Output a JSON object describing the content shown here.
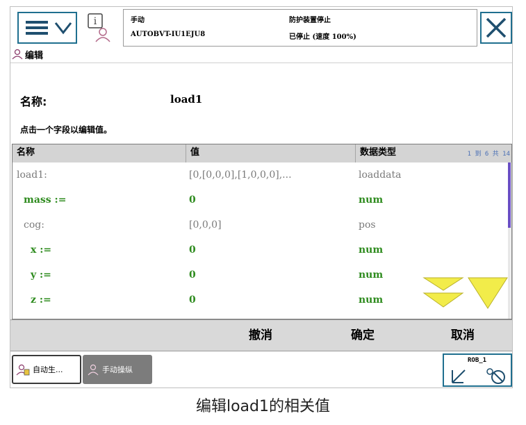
{
  "topbar": {
    "mode": "手动",
    "controller": "AUTOBVT-IU1EJU8",
    "status": "防护装置停止",
    "state": "已停止 (速度 100%)"
  },
  "tab": {
    "label": "编辑"
  },
  "form": {
    "name_label": "名称:",
    "name_value": "load1",
    "instruction": "点击一个字段以编辑值。"
  },
  "table": {
    "headers": [
      "名称",
      "值",
      "数据类型"
    ],
    "pager": "1 到 6 共 14",
    "rows": [
      {
        "name": "load1:",
        "value": "[0,[0,0,0],[1,0,0,0],...",
        "type": "loaddata",
        "style": "grey"
      },
      {
        "name": "mass :=",
        "value": "0",
        "type": "num",
        "style": "green"
      },
      {
        "name": "cog:",
        "value": "[0,0,0]",
        "type": "pos",
        "style": "grey"
      },
      {
        "name": "x :=",
        "value": "0",
        "type": "num",
        "style": "green"
      },
      {
        "name": "y :=",
        "value": "0",
        "type": "num",
        "style": "green"
      },
      {
        "name": "z :=",
        "value": "0",
        "type": "num",
        "style": "green"
      }
    ]
  },
  "actions": {
    "undo": "撤消",
    "ok": "确定",
    "cancel": "取消"
  },
  "taskbar": {
    "task1": "自动生...",
    "task2": "手动操纵",
    "robot": "ROB_1"
  },
  "caption": "编辑load1的相关值",
  "colors": {
    "accent": "#1f6f8f",
    "green_text": "#2e8b1e",
    "scroll": "#6a4fc5"
  }
}
